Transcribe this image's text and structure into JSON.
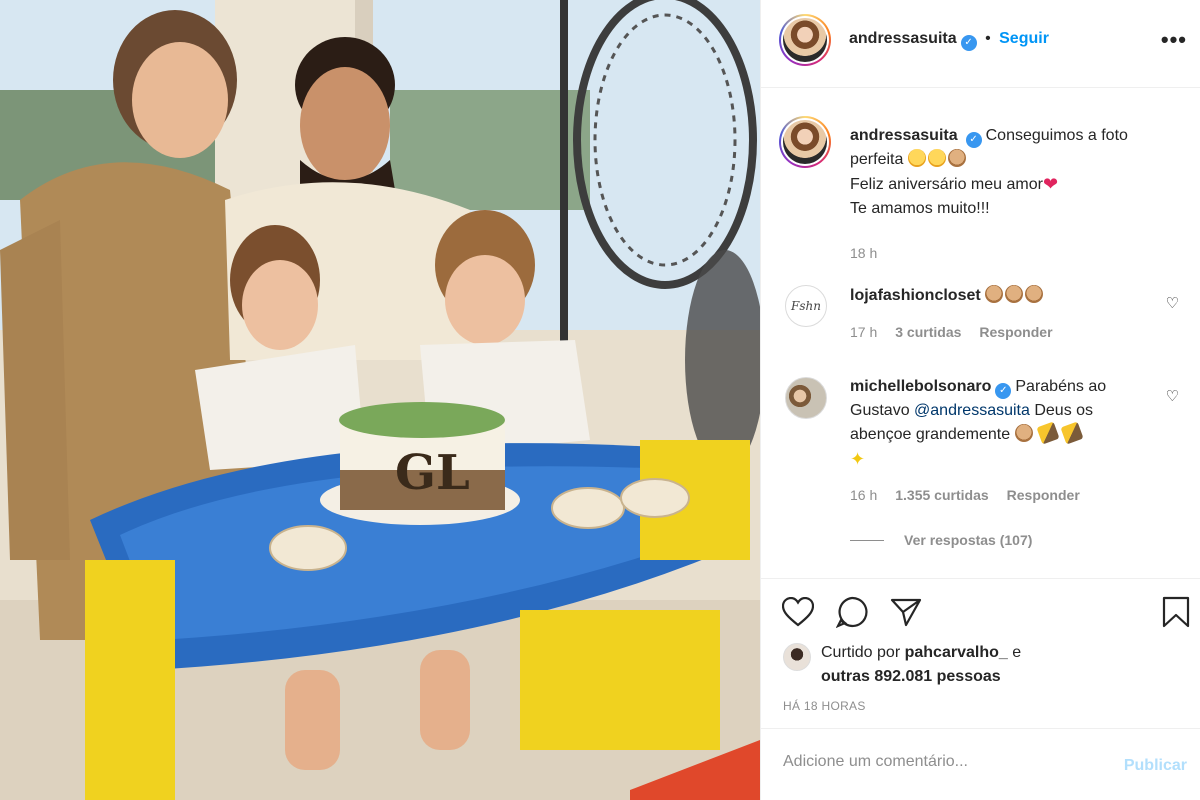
{
  "post": {
    "username": "andressasuita",
    "follow_label": "Seguir",
    "dot": "•",
    "more_label": "•••"
  },
  "photo": {
    "cake_monogram": "GL"
  },
  "caption": {
    "username": "andressasuita",
    "line1": "Conseguimos a foto perfeita",
    "line2": "Feliz aniversário meu amor",
    "line3": "Te amamos muito!!!",
    "time": "18 h"
  },
  "comments": [
    {
      "username": "lojafashioncloset",
      "avatar_text": "Fshn",
      "text": "",
      "time": "17 h",
      "likes": "3 curtidas",
      "reply": "Responder"
    },
    {
      "username": "michellebolsonaro",
      "text_before": "Parabéns ao Gustavo ",
      "mention": "@andressasuita",
      "text_after": " Deus os abençoe grandemente",
      "time": "16 h",
      "likes": "1.355 curtidas",
      "reply": "Responder"
    }
  ],
  "view_replies": "Ver respostas (107)",
  "likes": {
    "prefix": "Curtido por",
    "user": "pahcarvalho_",
    "middle": "e",
    "others": "outras 892.081 pessoas"
  },
  "time_ago": "HÁ 18 HORAS",
  "comment_box": {
    "placeholder": "Adicione um comentário...",
    "publish_label": "Publicar"
  },
  "colors": {
    "link": "#0095f6",
    "verified": "#3897f0",
    "publish_disabled": "#b2dffc"
  }
}
